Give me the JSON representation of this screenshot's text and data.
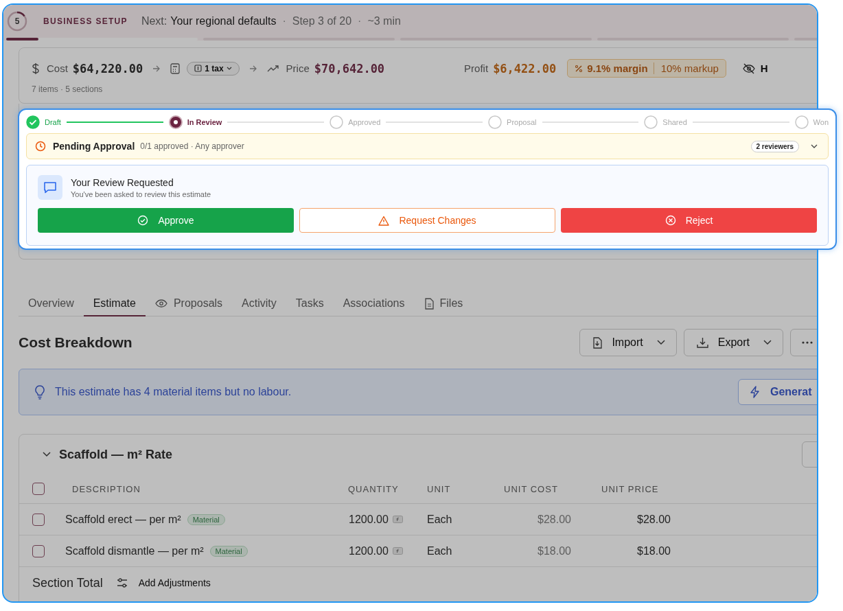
{
  "onboarding": {
    "step_badge": "5",
    "ring": {
      "level": 0.15
    },
    "title": "BUSINESS SETUP",
    "next_label": "Next:",
    "next_value": "Your regional defaults",
    "details": [
      {
        "separator": "·",
        "text": "Step 3 of 20"
      },
      {
        "separator": "·",
        "text": "~3 min"
      }
    ],
    "current_progress": {
      "level": 0.17
    }
  },
  "summary": {
    "cost_label": "Cost",
    "cost": "$64,220.00",
    "tax": "1 tax",
    "price_label": "Price",
    "price": "$70,642.00",
    "profit_label": "Profit",
    "profit": "$6,422.00",
    "margin": "9.1% margin",
    "markup": "10% markup",
    "hide_label": "H",
    "meta": "7 items · 5 sections"
  },
  "stepper": [
    {
      "label": "Draft",
      "completed": true,
      "selected": false
    },
    {
      "label": "In Review",
      "completed": false,
      "selected": true
    },
    {
      "label": "Approved",
      "completed": false,
      "selected": false
    },
    {
      "label": "Proposal",
      "completed": false,
      "selected": false
    },
    {
      "label": "Shared",
      "completed": false,
      "selected": false
    },
    {
      "label": "Won",
      "completed": false,
      "selected": false
    }
  ],
  "approval": {
    "title": "Pending Approval",
    "detail": "0/1 approved · Any approver",
    "reviewers": "2 reviewers"
  },
  "review": {
    "title": "Your Review Requested",
    "subtitle": "You've been asked to review this estimate",
    "buttons": [
      {
        "label": "Approve",
        "kind": "approve"
      },
      {
        "label": "Request Changes",
        "kind": "changes"
      },
      {
        "label": "Reject",
        "kind": "reject"
      }
    ]
  },
  "tabs": [
    {
      "label": "Overview",
      "selected": false
    },
    {
      "label": "Estimate",
      "selected": true
    },
    {
      "label": "Proposals",
      "selected": false
    },
    {
      "label": "Activity",
      "selected": false
    },
    {
      "label": "Tasks",
      "selected": false
    },
    {
      "label": "Associations",
      "selected": false
    },
    {
      "label": "Files",
      "selected": false
    }
  ],
  "heading": "Cost Breakdown",
  "actions": [
    {
      "label": "Import",
      "kind": "import"
    },
    {
      "label": "Export",
      "kind": "export"
    }
  ],
  "banner": {
    "text": "This estimate has 4 material items but no labour.",
    "button": "Generat"
  },
  "section": {
    "title": "Scaffold — m² Rate",
    "select_all_checked": false,
    "columns": [
      "DESCRIPTION",
      "QUANTITY",
      "UNIT",
      "UNIT COST",
      "UNIT PRICE"
    ],
    "rows": [
      {
        "description": "Scaffold erect — per m²",
        "tag": "Material",
        "quantity": "1200.00",
        "unit": "Each",
        "unit_cost": "$28.00",
        "unit_price": "$28.00",
        "checked": false
      },
      {
        "description": "Scaffold dismantle — per m²",
        "tag": "Material",
        "quantity": "1200.00",
        "unit": "Each",
        "unit_cost": "$18.00",
        "unit_price": "$18.00",
        "checked": false
      }
    ],
    "total_label": "Section Total",
    "adjustments": "Add Adjustments"
  }
}
